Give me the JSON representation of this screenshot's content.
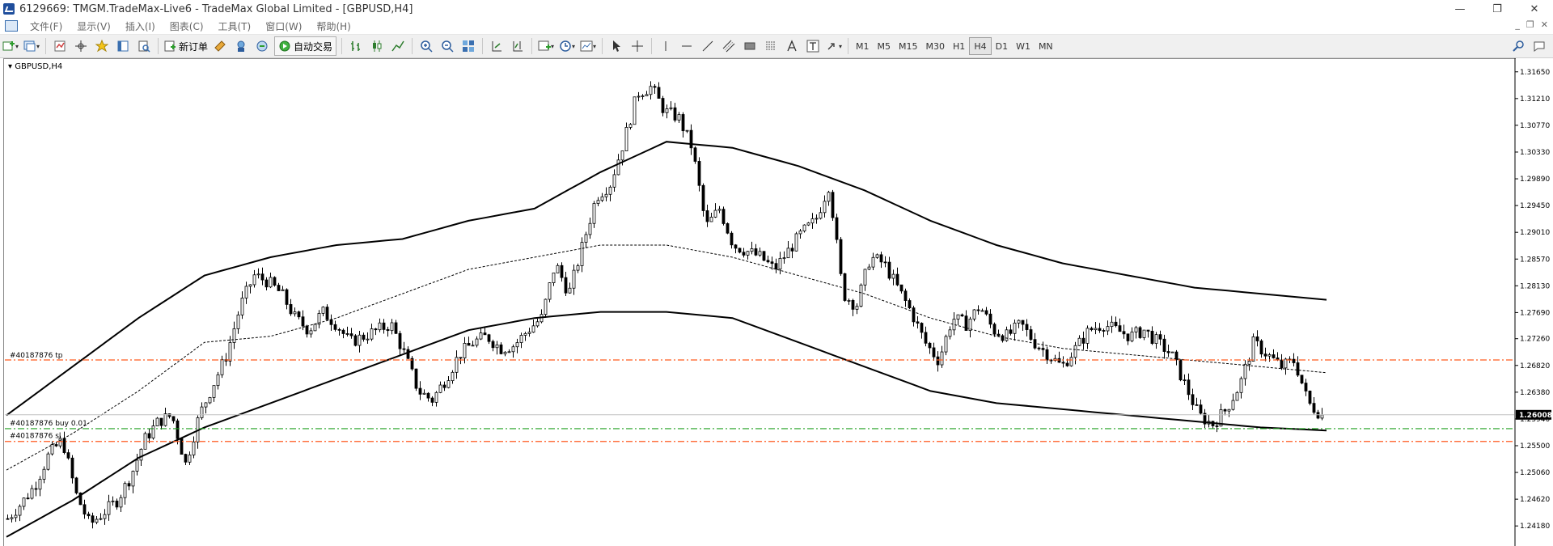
{
  "window": {
    "title": "6129669: TMGM.TradeMax-Live6 - TradeMax Global Limited - [GBPUSD,H4]",
    "minimize": "—",
    "restore": "❐",
    "close": "✕"
  },
  "menu": {
    "items": [
      "文件(F)",
      "显示(V)",
      "插入(I)",
      "图表(C)",
      "工具(T)",
      "窗口(W)",
      "帮助(H)"
    ],
    "mdi_buttons": [
      "_",
      "❐",
      "✕"
    ]
  },
  "toolbar": {
    "new_order_label": "新订单",
    "auto_trade_label": "自动交易",
    "timeframes": [
      "M1",
      "M5",
      "M15",
      "M30",
      "H1",
      "H4",
      "D1",
      "W1",
      "MN"
    ],
    "active_timeframe": "H4",
    "icons": [
      "new-chart-icon",
      "profiles-icon",
      "market-watch-icon",
      "navigator-icon",
      "favorites-icon",
      "terminal-icon",
      "strategy-tester-icon",
      "new-order-icon",
      "metaeditor-icon",
      "signals-icon",
      "trading-icon",
      "auto-trading-icon",
      "bar-chart-icon",
      "candlestick-icon",
      "line-chart-icon",
      "zoom-in-icon",
      "zoom-out-icon",
      "tile-windows-icon",
      "auto-scroll-icon",
      "chart-shift-icon",
      "indicators-icon",
      "periods-icon",
      "templates-icon",
      "cursor-icon",
      "crosshair-icon",
      "vertical-line-icon",
      "horizontal-line-icon",
      "trendline-icon",
      "equidistant-channel-icon",
      "rectangle-icon",
      "fibonacci-icon",
      "text-icon",
      "text-label-icon",
      "arrows-icon",
      "search-icon",
      "chat-icon"
    ]
  },
  "colors": {
    "order_line": "#ff5a1f",
    "buy_line": "#1f9f1f",
    "price_tag_bg": "#000000",
    "price_tag_text": "#ffffff"
  },
  "chart": {
    "symbol_label": "GBPUSD,H4",
    "tp_label": "#40187876 tp",
    "entry_label": "#40187876 buy 0.01",
    "sl_label": "#40187876 sl",
    "current_price": "1.26008",
    "price_axis_labels": [
      "1.31650",
      "1.31210",
      "1.30770",
      "1.30330",
      "1.29890",
      "1.29450",
      "1.29010",
      "1.28570",
      "1.28130",
      "1.27690",
      "1.27260",
      "1.26820",
      "1.26380",
      "1.25940",
      "1.25500",
      "1.25060",
      "1.24620",
      "1.24180"
    ]
  },
  "chart_data": {
    "type": "candlestick",
    "symbol": "GBPUSD",
    "timeframe": "H4",
    "ylim": [
      1.2385,
      1.3182
    ],
    "y_ticks": [
      1.3165,
      1.3121,
      1.3077,
      1.3033,
      1.2989,
      1.2945,
      1.2901,
      1.2857,
      1.2813,
      1.2769,
      1.2726,
      1.2682,
      1.2638,
      1.2594,
      1.255,
      1.2506,
      1.2462,
      1.2418
    ],
    "close_series": [
      1.243,
      1.2455,
      1.2485,
      1.2535,
      1.256,
      1.247,
      1.242,
      1.244,
      1.246,
      1.25,
      1.256,
      1.259,
      1.26,
      1.252,
      1.26,
      1.265,
      1.27,
      1.278,
      1.283,
      1.282,
      1.28,
      1.276,
      1.274,
      1.277,
      1.275,
      1.272,
      1.273,
      1.274,
      1.275,
      1.27,
      1.264,
      1.2625,
      1.266,
      1.27,
      1.272,
      1.273,
      1.271,
      1.2715,
      1.274,
      1.276,
      1.285,
      1.28,
      1.288,
      1.296,
      1.298,
      1.305,
      1.313,
      1.314,
      1.31,
      1.309,
      1.304,
      1.291,
      1.294,
      1.288,
      1.287,
      1.286,
      1.284,
      1.287,
      1.29,
      1.292,
      1.298,
      1.28,
      1.278,
      1.286,
      1.285,
      1.281,
      1.277,
      1.272,
      1.269,
      1.276,
      1.275,
      1.278,
      1.274,
      1.273,
      1.275,
      1.272,
      1.27,
      1.268,
      1.271,
      1.274,
      1.275,
      1.274,
      1.273,
      1.274,
      1.272,
      1.27,
      1.265,
      1.26,
      1.2585,
      1.261,
      1.265,
      1.272,
      1.27,
      1.268,
      1.269,
      1.262,
      1.26
    ],
    "upper_band": [
      1.26,
      1.268,
      1.276,
      1.283,
      1.286,
      1.288,
      1.289,
      1.292,
      1.294,
      1.3,
      1.305,
      1.304,
      1.301,
      1.297,
      1.292,
      1.288,
      1.285,
      1.283,
      1.281,
      1.28,
      1.279
    ],
    "middle_band": [
      1.251,
      1.257,
      1.264,
      1.272,
      1.273,
      1.276,
      1.28,
      1.284,
      1.286,
      1.288,
      1.288,
      1.286,
      1.283,
      1.28,
      1.276,
      1.273,
      1.271,
      1.27,
      1.269,
      1.268,
      1.267
    ],
    "lower_band": [
      1.24,
      1.246,
      1.253,
      1.258,
      1.262,
      1.266,
      1.27,
      1.274,
      1.276,
      1.277,
      1.277,
      1.276,
      1.272,
      1.268,
      1.264,
      1.262,
      1.261,
      1.26,
      1.259,
      1.258,
      1.2575
    ],
    "tp_level": 1.2691,
    "entry_level": 1.2578,
    "sl_level": 1.2557,
    "current_price": 1.26008
  }
}
